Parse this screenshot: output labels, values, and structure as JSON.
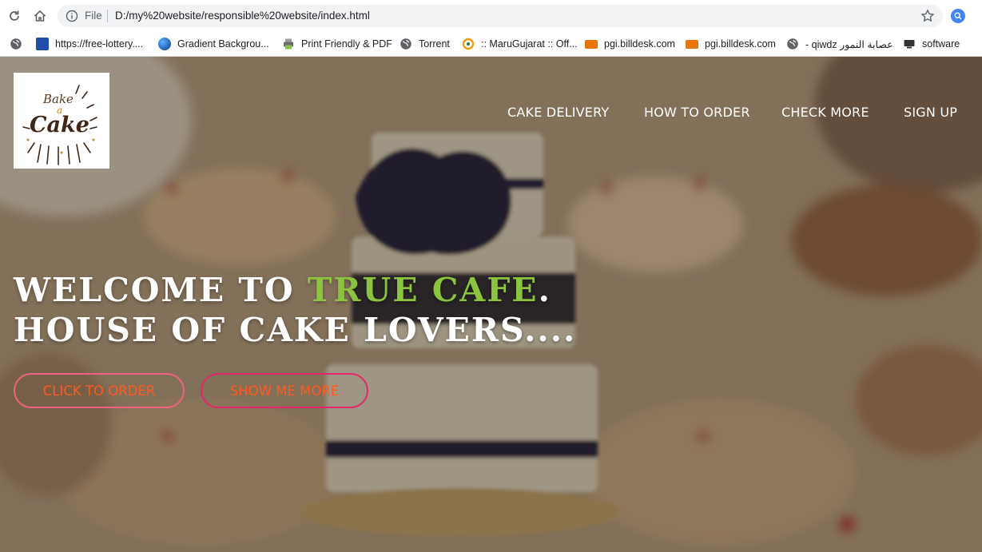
{
  "browser": {
    "url_scheme_label": "File",
    "url": "D:/my%20website/responsible%20website/index.html",
    "bookmarks": [
      {
        "label": "https://free-lottery....",
        "icon": "lottery-favicon-icon"
      },
      {
        "label": "Gradient Backgrou...",
        "icon": "gradient-circle-icon"
      },
      {
        "label": "Print Friendly & PDF",
        "icon": "printer-icon"
      },
      {
        "label": "Torrent",
        "icon": "globe-icon"
      },
      {
        "label": ":: MaruGujarat :: Off...",
        "icon": "marugujarat-favicon-icon"
      },
      {
        "label": "pgi.billdesk.com",
        "icon": "billdesk-favicon-icon"
      },
      {
        "label": "pgi.billdesk.com",
        "icon": "billdesk-favicon-icon"
      },
      {
        "label": "- qiwdz عصابة النمور",
        "icon": "globe-icon"
      },
      {
        "label": "software",
        "icon": "software-icon"
      }
    ]
  },
  "site": {
    "logo": {
      "line1": "Bake",
      "line2": "a",
      "line3": "Cake"
    },
    "nav": [
      "CAKE DELIVERY",
      "HOW TO ORDER",
      "CHECK MORE",
      "SIGN UP"
    ],
    "headline": {
      "line1_prefix": "WELCOME TO ",
      "line1_accent": "TRUE CAFE",
      "line1_suffix": ".",
      "line2": "HOUSE OF CAKE LOVERS...."
    },
    "buttons": {
      "order": "CLICK TO ORDER",
      "more": "SHOW ME MORE"
    }
  },
  "colors": {
    "accent_green": "#8bc43f",
    "button_text": "#ff5a1f",
    "button_border_order": "#f0637f",
    "button_border_more": "#e3276b"
  }
}
